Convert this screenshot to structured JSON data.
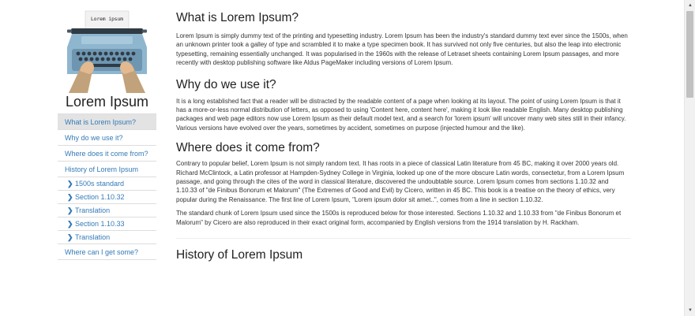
{
  "sidebar": {
    "logo_paper_text": "Lorem ipsum",
    "site_title": "Lorem Ipsum",
    "nav": [
      {
        "label": "What is Lorem Ipsum?"
      },
      {
        "label": "Why do we use it?"
      },
      {
        "label": "Where does it come from?"
      },
      {
        "label": "History of Lorem Ipsum"
      }
    ],
    "sub_nav": [
      {
        "label": "1500s standard",
        "icon": "chevron-right-icon"
      },
      {
        "label": "Section 1.10.32",
        "icon": "chevron-right-icon"
      },
      {
        "label": "Translation",
        "icon": "chevron-right-icon"
      },
      {
        "label": "Section 1.10.33",
        "icon": "chevron-right-icon"
      },
      {
        "label": "Translation",
        "icon": "chevron-right-icon"
      }
    ],
    "last_nav": {
      "label": "Where can I get some?"
    }
  },
  "main": {
    "sections": [
      {
        "heading": "What is Lorem Ipsum?",
        "paragraphs": [
          "Lorem Ipsum is simply dummy text of the printing and typesetting industry. Lorem Ipsum has been the industry's standard dummy text ever since the 1500s, when an unknown printer took a galley of type and scrambled it to make a type specimen book. It has survived not only five centuries, but also the leap into electronic typesetting, remaining essentially unchanged. It was popularised in the 1960s with the release of Letraset sheets containing Lorem Ipsum passages, and more recently with desktop publishing software like Aldus PageMaker including versions of Lorem Ipsum."
        ]
      },
      {
        "heading": "Why do we use it?",
        "paragraphs": [
          "It is a long established fact that a reader will be distracted by the readable content of a page when looking at its layout. The point of using Lorem Ipsum is that it has a more-or-less normal distribution of letters, as opposed to using 'Content here, content here', making it look like readable English. Many desktop publishing packages and web page editors now use Lorem Ipsum as their default model text, and a search for 'lorem ipsum' will uncover many web sites still in their infancy. Various versions have evolved over the years, sometimes by accident, sometimes on purpose (injected humour and the like)."
        ]
      },
      {
        "heading": "Where does it come from?",
        "paragraphs": [
          "Contrary to popular belief, Lorem Ipsum is not simply random text. It has roots in a piece of classical Latin literature from 45 BC, making it over 2000 years old. Richard McClintock, a Latin professor at Hampden-Sydney College in Virginia, looked up one of the more obscure Latin words, consectetur, from a Lorem Ipsum passage, and going through the cites of the word in classical literature, discovered the undoubtable source. Lorem Ipsum comes from sections 1.10.32 and 1.10.33 of \"de Finibus Bonorum et Malorum\" (The Extremes of Good and Evil) by Cicero, written in 45 BC. This book is a treatise on the theory of ethics, very popular during the Renaissance. The first line of Lorem Ipsum, \"Lorem ipsum dolor sit amet..\", comes from a line in section 1.10.32.",
          "The standard chunk of Lorem Ipsum used since the 1500s is reproduced below for those interested. Sections 1.10.32 and 1.10.33 from \"de Finibus Bonorum et Malorum\" by Cicero are also reproduced in their exact original form, accompanied by English versions from the 1914 translation by H. Rackham."
        ]
      },
      {
        "heading": "History of Lorem Ipsum"
      }
    ]
  },
  "colors": {
    "link": "#337ab7",
    "active_bg": "#e3e3e3",
    "typewriter_body": "#8fb6cf",
    "typewriter_dark": "#2f3b45",
    "hands": "#e3b98f",
    "sleeves": "#c2a27b"
  }
}
